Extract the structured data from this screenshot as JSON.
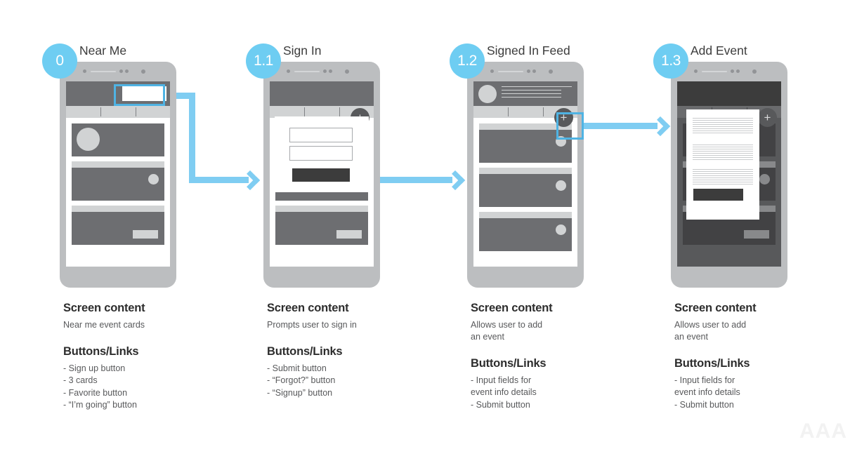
{
  "diagram": {
    "title_watermark": "AAA",
    "accent_color": "#6ecdf2",
    "arrow_color": "#7fcdf2",
    "highlight_color": "#4fb3e3",
    "fab_label": "+"
  },
  "steps": [
    {
      "badge": "0",
      "title": "Near Me",
      "screen_heading": "Screen content",
      "screen_desc": "Near me event cards",
      "buttons_heading": "Buttons/Links",
      "buttons": [
        "- Sign up button",
        "- 3 cards",
        "- Favorite button",
        "- “I’m going” button"
      ]
    },
    {
      "badge": "1.1",
      "title": "Sign In",
      "screen_heading": "Screen content",
      "screen_desc": "Prompts user to sign in",
      "buttons_heading": "Buttons/Links",
      "buttons": [
        "- Submit button",
        "- “Forgot?” button",
        "- “Signup” button"
      ]
    },
    {
      "badge": "1.2",
      "title": "Signed In Feed",
      "screen_heading": "Screen content",
      "screen_desc": "Allows user to add\nan event",
      "buttons_heading": "Buttons/Links",
      "buttons": [
        "- Input fields for",
        "event info details",
        "- Submit button"
      ]
    },
    {
      "badge": "1.3",
      "title": "Add Event",
      "screen_heading": "Screen content",
      "screen_desc": "Allows user to add\nan event",
      "buttons_heading": "Buttons/Links",
      "buttons": [
        "- Input fields for",
        "event info details",
        "- Submit button"
      ]
    }
  ]
}
